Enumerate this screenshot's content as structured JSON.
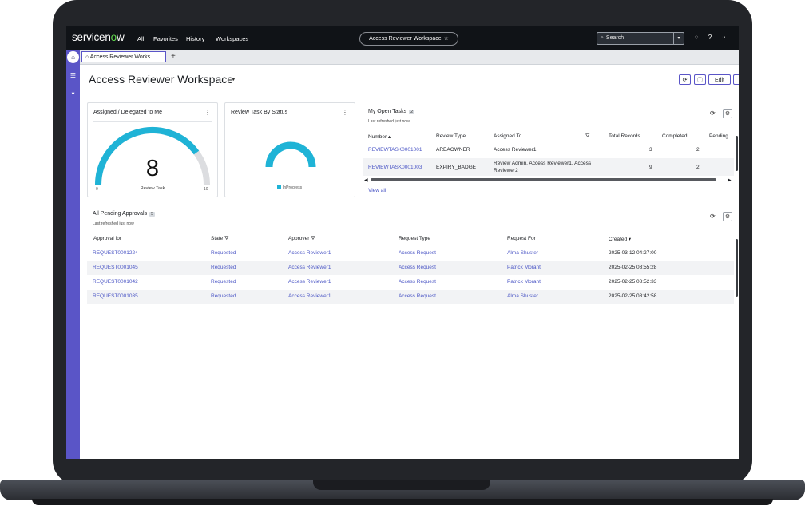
{
  "topnav": {
    "logo": "servicenow",
    "items": [
      "All",
      "Favorites",
      "History",
      "Workspaces"
    ],
    "workspace_pill": "Access Reviewer Workspace",
    "search_placeholder": "Search"
  },
  "tabs": {
    "active_tab": "Access Reviewer Works...",
    "add": "+"
  },
  "header": {
    "title": "Access Reviewer Workspace",
    "edit_button": "Edit"
  },
  "gauge_card": {
    "title": "Assigned / Delegated to Me",
    "value": "8",
    "label": "Review Task",
    "min": "0",
    "max": "10",
    "value_fraction": 0.8,
    "color": "#1fb3d6"
  },
  "status_card": {
    "title": "Review Task By Status",
    "legend": "InProgress",
    "color": "#1fb3d6"
  },
  "open_tasks": {
    "title": "My Open Tasks",
    "count": "2",
    "refreshed": "Last refreshed just now",
    "columns": [
      "Number",
      "Review Type",
      "Assigned To",
      "Total Records",
      "Completed",
      "Pending"
    ],
    "rows": [
      {
        "number": "REVIEWTASK0001001",
        "type": "AREAOWNER",
        "assigned_1": "Access Reviewer1",
        "assigned_2": "",
        "total": "3",
        "completed": "2"
      },
      {
        "number": "REVIEWTASK0001003",
        "type": "EXPIRY_BADGE",
        "assigned_1": "Review Admin, Access Reviewer1, Access",
        "assigned_2": "Reviewer2",
        "total": "9",
        "completed": "2"
      }
    ],
    "view_all": "View all"
  },
  "pending_approvals": {
    "title": "All Pending Approvals",
    "count": "5",
    "refreshed": "Last refreshed just now",
    "columns": [
      "Approval for",
      "State",
      "Approver",
      "Request Type",
      "Request For",
      "Created"
    ],
    "rows": [
      {
        "approval": "REQUEST0001224",
        "state": "Requested",
        "approver": "Access Reviewer1",
        "type": "Access Request",
        "for": "Alma Shuster",
        "created": "2025-03-12 04:27:00"
      },
      {
        "approval": "REQUEST0001045",
        "state": "Requested",
        "approver": "Access Reviewer1",
        "type": "Access Request",
        "for": "Patrick Morant",
        "created": "2025-02-25 08:55:28"
      },
      {
        "approval": "REQUEST0001042",
        "state": "Requested",
        "approver": "Access Reviewer1",
        "type": "Access Request",
        "for": "Patrick Morant",
        "created": "2025-02-25 08:52:33"
      },
      {
        "approval": "REQUEST0001035",
        "state": "Requested",
        "approver": "Access Reviewer1",
        "type": "Access Request",
        "for": "Alma Shuster",
        "created": "2025-02-25 08:42:58"
      }
    ]
  }
}
